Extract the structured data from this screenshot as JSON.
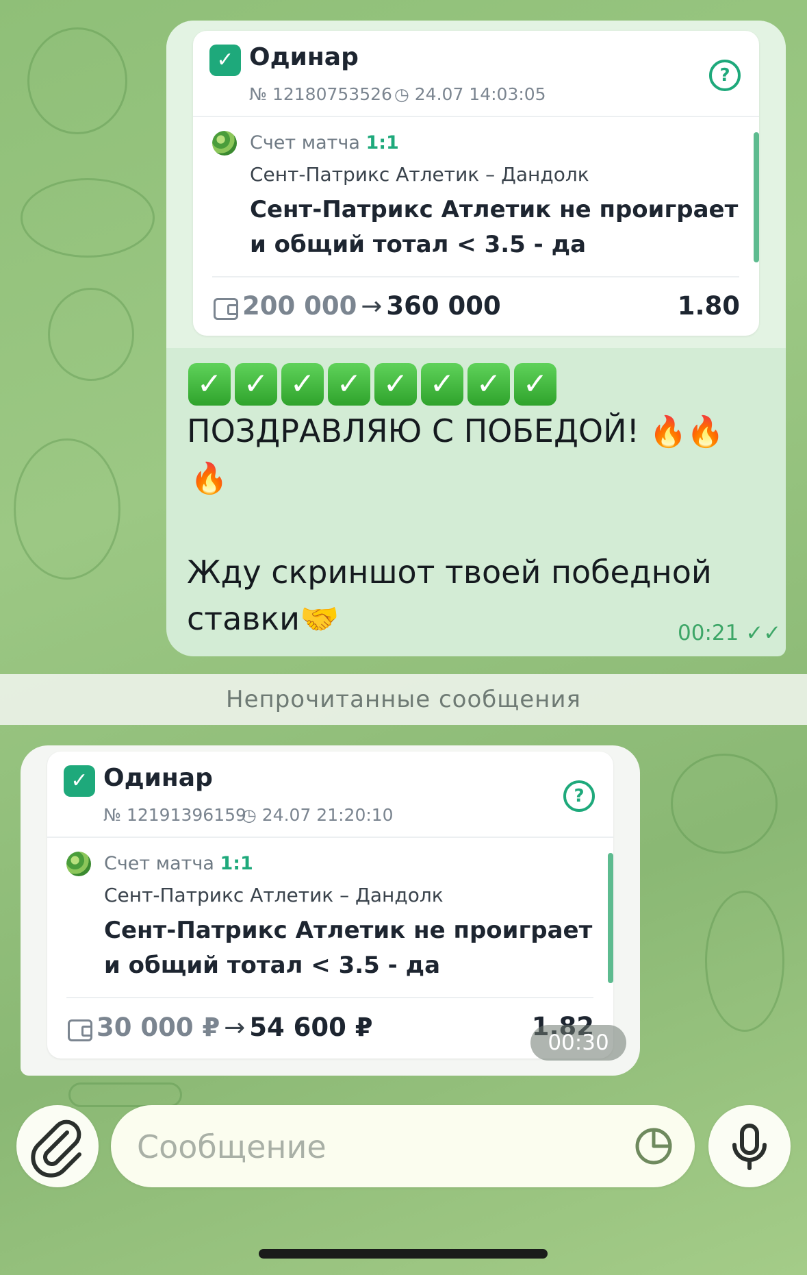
{
  "messages": [
    {
      "bet": {
        "title": "Одинар",
        "number": "№ 12180753526",
        "datetime": "24.07 14:03:05",
        "score_label": "Счет матча",
        "score_value": "1:1",
        "teams": "Сент-Патрикс Атлетик – Дандолк",
        "outcome_line1": "Сент-Патрикс Атлетик не проиграет",
        "outcome_line2": "и общий тотал < 3.5 - да",
        "stake": "200 000",
        "payout": "360 000",
        "odds": "1.80"
      },
      "text_line1": "ПОЗДРАВЛЯЮ С ПОБЕДОЙ!",
      "text_line3": "Жду скриншот твоей победной",
      "text_line4": "ставки",
      "time": "00:21"
    },
    {
      "bet": {
        "title": "Одинар",
        "number": "№ 12191396159",
        "datetime": "24.07 21:20:10",
        "score_label": "Счет матча",
        "score_value": "1:1",
        "teams": "Сент-Патрикс Атлетик – Дандолк",
        "outcome_line1": "Сент-Патрикс Атлетик не проиграет",
        "outcome_line2": "и общий тотал < 3.5 - да",
        "stake": "30 000 ₽",
        "payout": "54 600 ₽",
        "odds": "1.82"
      },
      "time": "00:30"
    }
  ],
  "unread_separator": "Непрочитанные сообщения",
  "composer": {
    "placeholder": "Сообщение",
    "icons": [
      "paperclip-icon",
      "sticker-icon",
      "microphone-icon"
    ]
  },
  "colors": {
    "accent": "#1ea97b",
    "outgoing_bubble": "#d3ecd5",
    "time_green": "#3da667"
  }
}
